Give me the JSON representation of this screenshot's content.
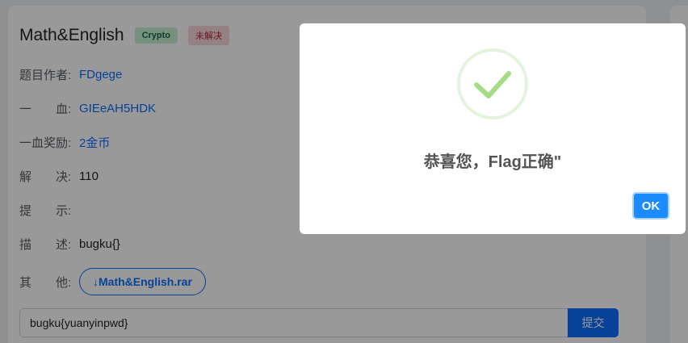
{
  "challenge": {
    "title": "Math&English",
    "category_badge": "Crypto",
    "status_badge": "未解决",
    "fields": {
      "author": {
        "label": "题目作者:",
        "value": "FDgege"
      },
      "first_blood": {
        "label": "一　　血:",
        "value": "GIEeAH5HDK"
      },
      "first_blood_reward": {
        "label": "一血奖励:",
        "value": "2金币"
      },
      "solves": {
        "label": "解　　决:",
        "value": "110"
      },
      "hint": {
        "label": "提　　示:",
        "value": ""
      },
      "description": {
        "label": "描　　述:",
        "value": "bugku{}"
      },
      "other": {
        "label": "其　　他:"
      }
    },
    "download_label": "↓Math&English.rar",
    "flag_input_value": "bugku{yuanyinpwd}",
    "submit_label": "提交"
  },
  "dialog": {
    "message": "恭喜您，Flag正确\"",
    "ok_label": "OK",
    "colors": {
      "ok_button": "#1a8cff",
      "success": "#a5dc86"
    }
  }
}
